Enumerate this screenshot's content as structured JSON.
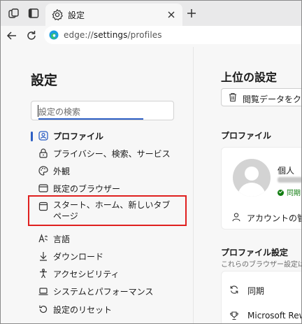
{
  "browser": {
    "tab_title": "設定",
    "url_prefix": "edge://",
    "url_main": "settings",
    "url_suffix": "/profiles"
  },
  "sidebar": {
    "title": "設定",
    "search_placeholder": "設定の検索",
    "items": [
      {
        "label": "プロファイル",
        "icon": "profile-icon",
        "active": true
      },
      {
        "label": "プライバシー、検索、サービス",
        "icon": "lock-icon"
      },
      {
        "label": "外観",
        "icon": "palette-icon"
      },
      {
        "label": "既定のブラウザー",
        "icon": "browser-icon"
      },
      {
        "label": "スタート、ホーム、新しいタブ ページ",
        "icon": "home-page-icon"
      },
      {
        "label": "言語",
        "icon": "language-icon"
      },
      {
        "label": "ダウンロード",
        "icon": "download-icon"
      },
      {
        "label": "アクセシビリティ",
        "icon": "accessibility-icon"
      },
      {
        "label": "システムとパフォーマンス",
        "icon": "laptop-icon"
      },
      {
        "label": "設定のリセット",
        "icon": "reset-icon"
      }
    ]
  },
  "main": {
    "title": "上位の設定",
    "clear_button": "閲覧データをクリ",
    "profile_section": "プロファイル",
    "profile_name": "個人",
    "sync_status": "同期は",
    "account_manage": "アカウントの管",
    "profile_settings_title": "プロファイル設定",
    "profile_settings_sub": "これらのブラウザー設定は",
    "rows": [
      {
        "label": "同期",
        "icon": "sync-icon"
      },
      {
        "label": "Microsoft Rewar",
        "icon": "trophy-icon"
      }
    ]
  },
  "colors": {
    "accent": "#2d5fc4",
    "highlight_border": "#e0201f",
    "sync_green": "#107c10"
  }
}
